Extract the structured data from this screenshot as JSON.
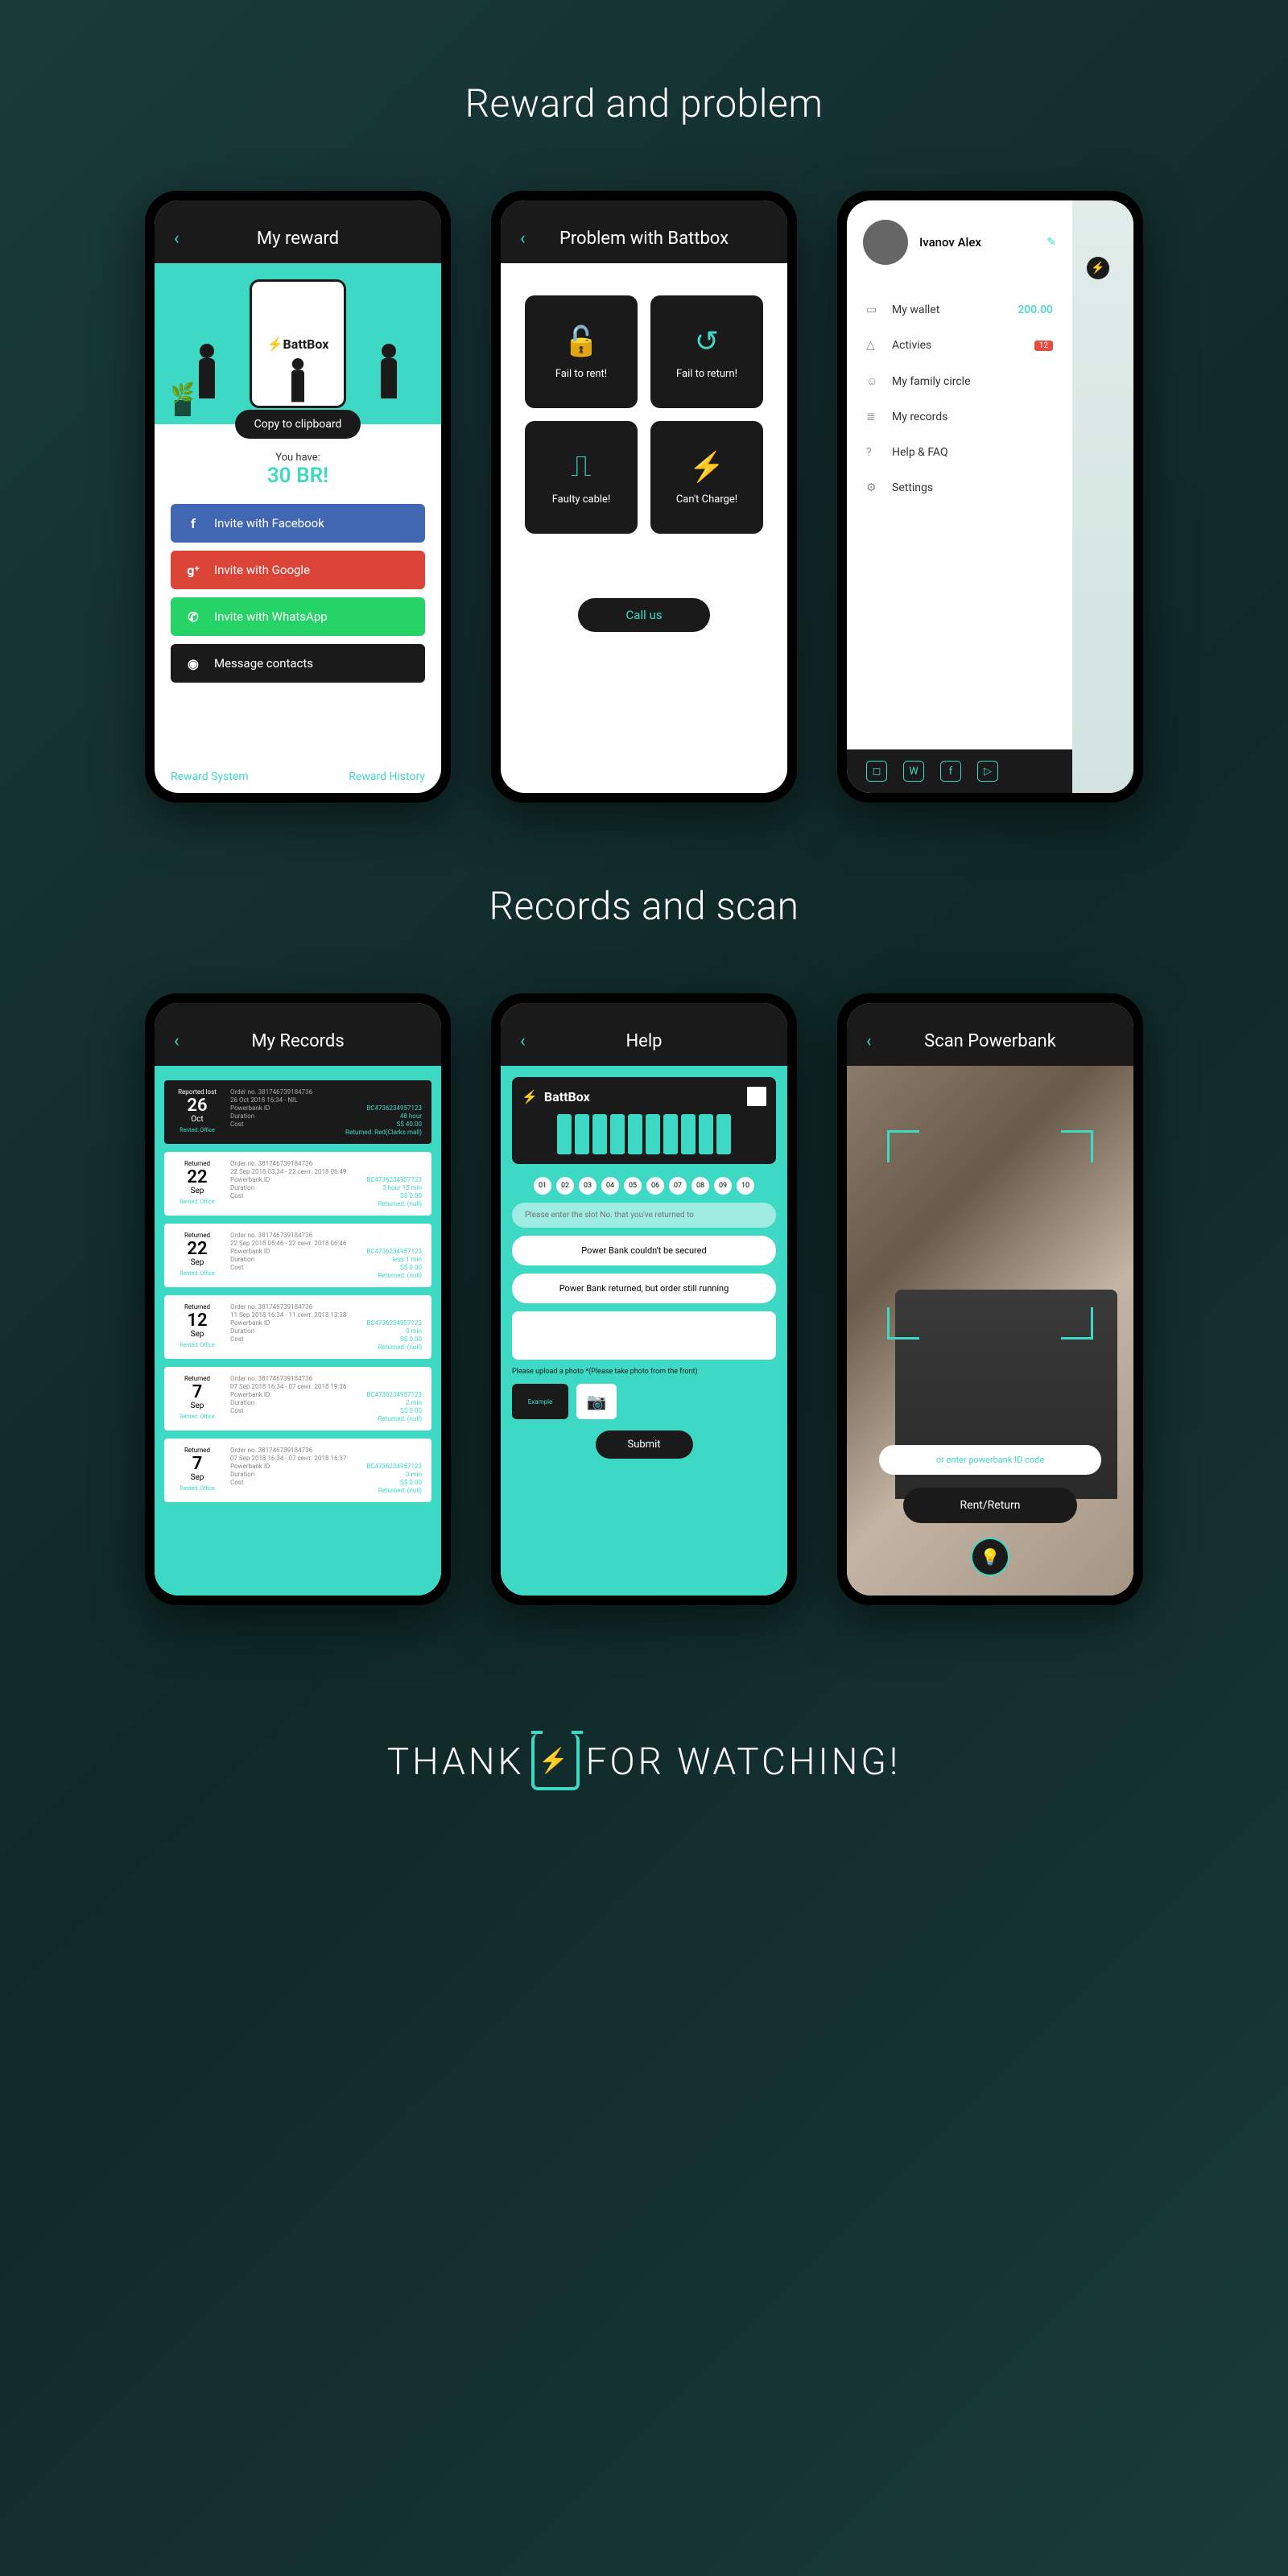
{
  "section1_title": "Reward and problem",
  "section2_title": "Records and scan",
  "footer": {
    "left": "THANK",
    "right": "FOR WATCHING!"
  },
  "reward": {
    "title": "My reward",
    "brand": "BattBox",
    "copy_btn": "Copy to clipboard",
    "you_have": "You have:",
    "amount": "30 BR!",
    "fb": "Invite with Facebook",
    "google": "Invite with Google",
    "whatsapp": "Invite with WhatsApp",
    "contacts": "Message contacts",
    "link_system": "Reward System",
    "link_history": "Reward History"
  },
  "problem": {
    "title": "Problem with Battbox",
    "tiles": [
      {
        "icon": "🔓",
        "label": "Fail to rent!"
      },
      {
        "icon": "↺",
        "label": "Fail to return!"
      },
      {
        "icon": "⎍",
        "label": "Faulty cable!"
      },
      {
        "icon": "⚡",
        "label": "Can't Charge!"
      }
    ],
    "call": "Call us"
  },
  "drawer": {
    "username": "Ivanov Alex",
    "items": [
      {
        "icon": "▭",
        "label": "My wallet",
        "value": "200.00"
      },
      {
        "icon": "△",
        "label": "Activies",
        "badge": "12"
      },
      {
        "icon": "☺",
        "label": "My family circle"
      },
      {
        "icon": "≣",
        "label": "My records"
      },
      {
        "icon": "?",
        "label": "Help & FAQ"
      },
      {
        "icon": "⚙",
        "label": "Settings"
      }
    ]
  },
  "records": {
    "title": "My Records",
    "items": [
      {
        "dark": true,
        "status": "Reported lost",
        "day": "26",
        "month": "Oct",
        "rented": "Rented: Office",
        "order": "Order no. 381746739184736",
        "time": "26 Oct 2018 16:34 - NIL",
        "pb_lbl": "Powerbank ID",
        "pb": "BC4736234957123",
        "dur_lbl": "Duration",
        "dur": "48 hour",
        "cost_lbl": "Cost",
        "cost": "S$ 40.00",
        "ret": "Returned: Red(Clarks mall)"
      },
      {
        "dark": false,
        "status": "Returned",
        "day": "22",
        "month": "Sep",
        "rented": "Rented: Office",
        "order": "Order no. 381746739184736",
        "time": "22 Sep 2018 03:34 - 22 сент. 2018 06:49",
        "pb_lbl": "Powerbank ID",
        "pb": "BC4736234957123",
        "dur_lbl": "Duration",
        "dur": "3 hour 15 min",
        "cost_lbl": "Cost",
        "cost": "S$ 0.00",
        "ret": "Returned: (null)"
      },
      {
        "dark": false,
        "status": "Returned",
        "day": "22",
        "month": "Sep",
        "rented": "Rented: Office",
        "order": "Order no. 381746739184736",
        "time": "22 Sep 2018 05:46 - 22 сент. 2018 06:46",
        "pb_lbl": "Powerbank ID",
        "pb": "BC4736234957123",
        "dur_lbl": "Duration",
        "dur": "less 1 min",
        "cost_lbl": "Cost",
        "cost": "S$ 0.00",
        "ret": "Returned: (null)"
      },
      {
        "dark": false,
        "status": "Returned",
        "day": "12",
        "month": "Sep",
        "rented": "Rented: Office",
        "order": "Order no. 381746739184736",
        "time": "11 Sep 2018 16:34 - 11 сент. 2018 13:38",
        "pb_lbl": "Powerbank ID",
        "pb": "BC4736234957123",
        "dur_lbl": "Duration",
        "dur": "0 min",
        "cost_lbl": "Cost",
        "cost": "S$ 0.00",
        "ret": "Returned: (null)"
      },
      {
        "dark": false,
        "status": "Returned",
        "day": "7",
        "month": "Sep",
        "rented": "Rented: Office",
        "order": "Order no. 381746739184736",
        "time": "07 Sep 2018 16:34 - 07 сент. 2018 19:36",
        "pb_lbl": "Powerbank ID",
        "pb": "BC4736234957123",
        "dur_lbl": "Duration",
        "dur": "2 min",
        "cost_lbl": "Cost",
        "cost": "S$ 0.00",
        "ret": "Returned: (null)"
      },
      {
        "dark": false,
        "status": "Returned",
        "day": "7",
        "month": "Sep",
        "rented": "Rented: Office",
        "order": "Order no. 381746739184736",
        "time": "07 Sep 2018 16:34 - 07 сент. 2018 16:37",
        "pb_lbl": "Powerbank ID",
        "pb": "BC4736234957123",
        "dur_lbl": "Duration",
        "dur": "3 min",
        "cost_lbl": "Cost",
        "cost": "S$ 0.00",
        "ret": "Returned: (null)"
      }
    ]
  },
  "help": {
    "title": "Help",
    "station": "BattBox",
    "slots": [
      "01",
      "02",
      "03",
      "04",
      "05",
      "06",
      "07",
      "08",
      "09",
      "10"
    ],
    "input_placeholder": "Please enter the slot No. that you've returned to",
    "opt1": "Power Bank couldn't be secured",
    "opt2": "Power Bank returned, but order still running",
    "upload_label": "Please upload a photo *(Please take photo from the front)",
    "thumb_label": "Example",
    "submit": "Submit"
  },
  "scan": {
    "title": "Scan Powerbank",
    "enter_code": "or enter powerbank ID code",
    "rent": "Rent/Return"
  }
}
